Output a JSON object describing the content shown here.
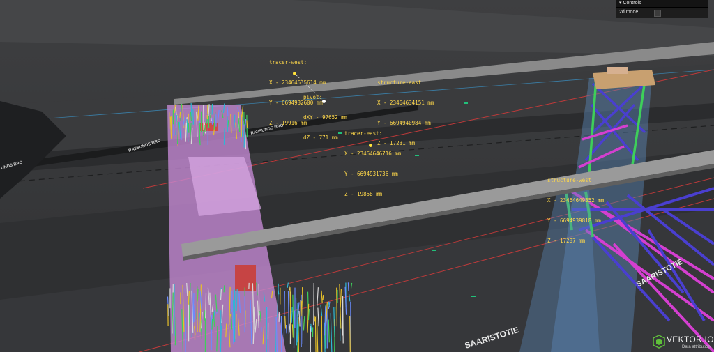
{
  "controls": {
    "title": "Controls",
    "toggle_icon": "chevron-down-icon",
    "mode_label": "2d mode",
    "mode_checked": false
  },
  "labels": {
    "tracer_west": {
      "title": "tracer-west:",
      "x": "X - 23464635614 mm",
      "y": "Y - 6694932600 mm",
      "z": "Z - 19916 mm"
    },
    "pivot": {
      "title": "pivot:",
      "dxy": "dXY - 97652 mm",
      "dz": "dZ - 771 mm"
    },
    "structure_east": {
      "title": "structure-east:",
      "x": "X - 23464634151 mm",
      "y": "Y - 6694940984 mm",
      "z": "Z - 17231 mm"
    },
    "tracer_east": {
      "title": "tracer-east:",
      "x": "X - 23464646716 mm",
      "y": "Y - 6694931736 mm",
      "z": "Z - 19858 mm"
    },
    "structure_west": {
      "title": "structure-west:",
      "x": "X - 23464649352 mm",
      "y": "Y - 6694939818 mm",
      "z": "Z - 17287 mm"
    }
  },
  "road_text": {
    "upper_left": "RAVSUNDS BRO",
    "upper_mid": "RAVSUNDS BRO",
    "left_edge": "UNDS BRO",
    "lower_right": "SAARISTOTIE",
    "lower_mid": "SAARISTOTIE"
  },
  "brand": {
    "name": "VEKTOR.IO",
    "attribution": "Data attribution",
    "logo_icon": "cube-logo-icon"
  },
  "colors": {
    "label": "#ffd84a",
    "lane": "#c03a3a",
    "marker": "#22c07a",
    "volume": "#c78ad6",
    "truss_blue": "#4a3fd0",
    "truss_magenta": "#d43fd0",
    "truss_green": "#3ecf5a",
    "beam": "#8a8a8a"
  }
}
